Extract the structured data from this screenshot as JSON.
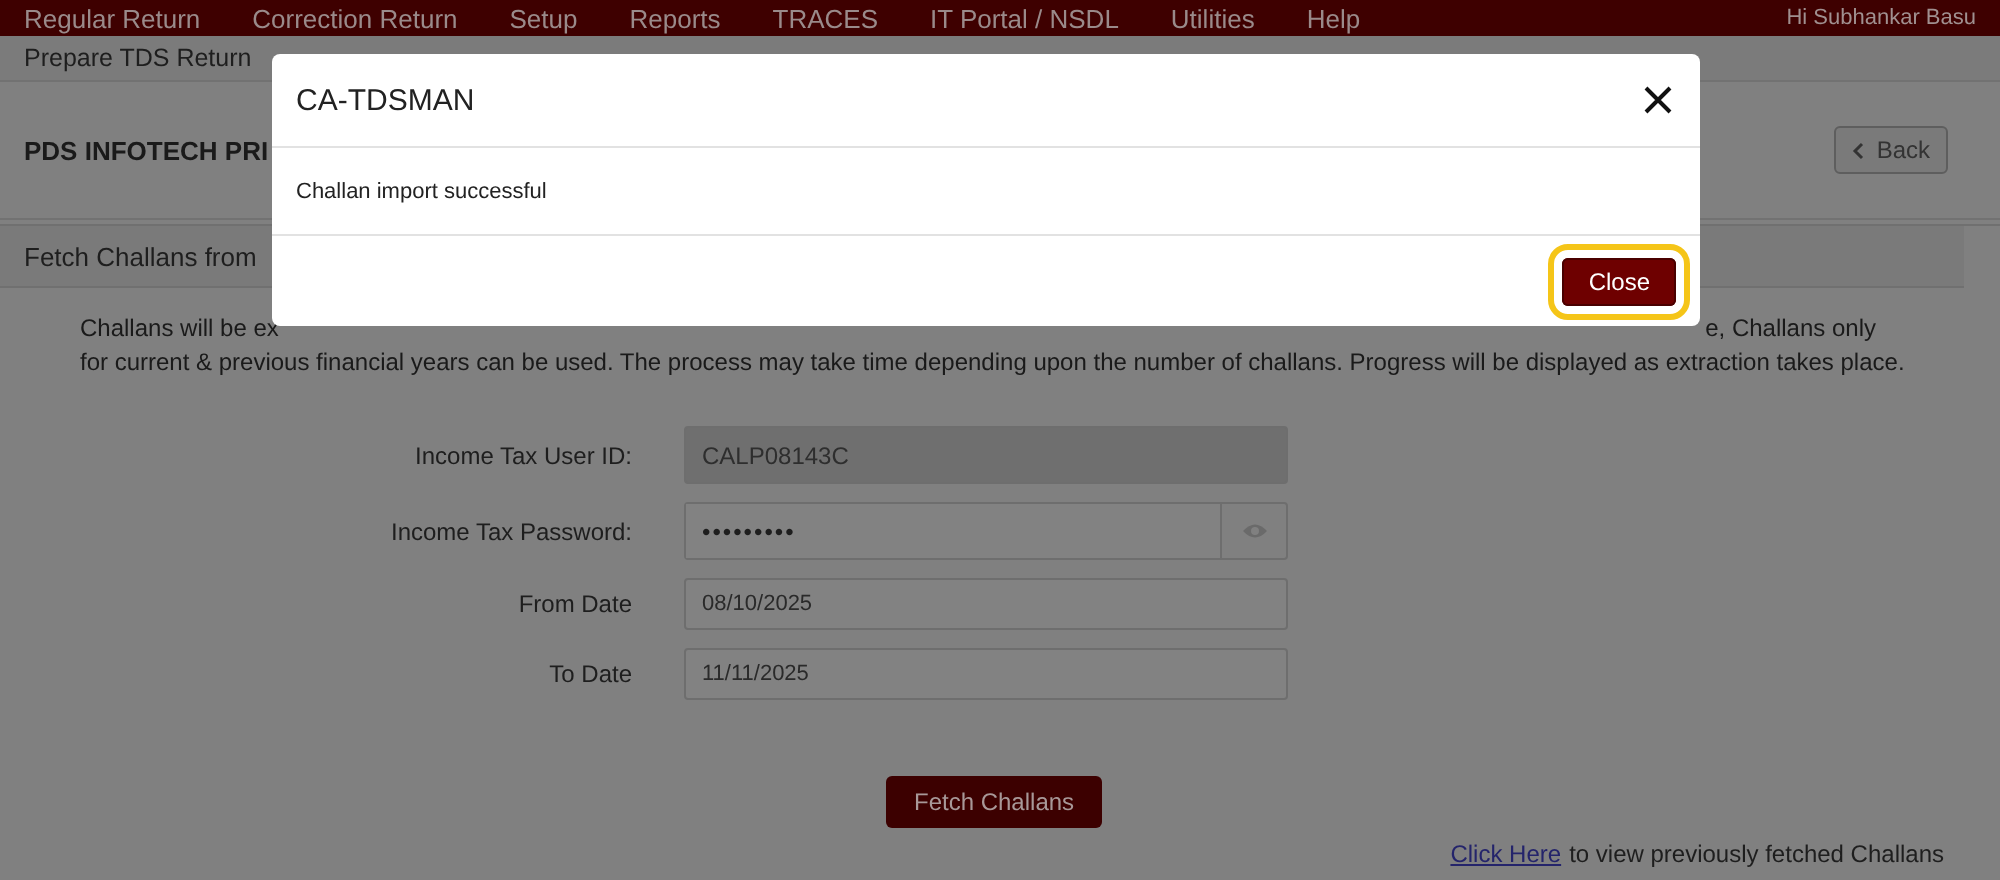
{
  "menu": [
    "Regular Return",
    "Correction Return",
    "Setup",
    "Reports",
    "TRACES",
    "IT Portal / NSDL",
    "Utilities",
    "Help"
  ],
  "greeting": "Hi Subhankar Basu",
  "breadcrumb": "Prepare TDS Return",
  "company": "PDS INFOTECH PRI",
  "back_button": "Back",
  "panel_title": "Fetch Challans from",
  "intro_line_1": [
    "Challans will be ex",
    "e, Challans only"
  ],
  "intro_line_2": "for current & previous financial years can be used. The process may take time depending upon the number of challans. Progress will be displayed as extraction takes place.",
  "fields": [
    {
      "label": "Income Tax User ID:",
      "value": "CALP08143C",
      "kind": "text",
      "disabled": true
    },
    {
      "label": "Income Tax Password:",
      "value": "•••••••••",
      "kind": "password",
      "disabled": false
    },
    {
      "label": "From Date",
      "value": "08/10/2025",
      "kind": "date",
      "disabled": false
    },
    {
      "label": "To Date",
      "value": "11/11/2025",
      "kind": "date",
      "disabled": false
    }
  ],
  "fetch_button": "Fetch Challans",
  "footer_link": {
    "link": "Click Here",
    "text": "to view previously fetched Challans"
  },
  "modal": {
    "title": "CA-TDSMAN",
    "message": "Challan import successful",
    "close_button": "Close",
    "close_focused": true
  }
}
